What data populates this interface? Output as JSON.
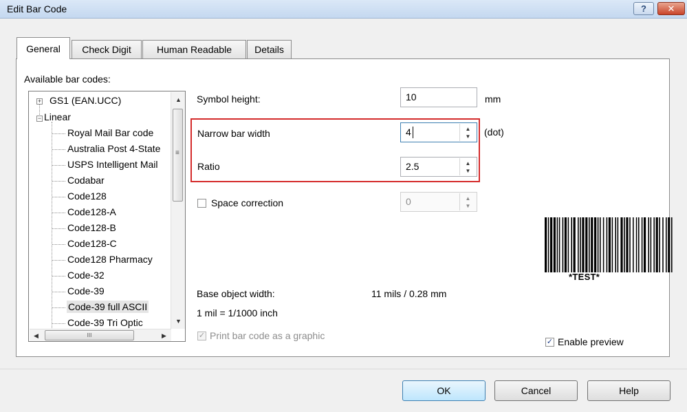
{
  "window": {
    "title": "Edit Bar Code",
    "help_glyph": "?",
    "close_glyph": "✕"
  },
  "tabs": [
    {
      "label": "General",
      "active": true
    },
    {
      "label": "Check Digit"
    },
    {
      "label": "Human Readable"
    },
    {
      "label": "Details"
    }
  ],
  "barcode_list": {
    "label": "Available bar codes:",
    "groups": [
      {
        "label": "GS1 (EAN.UCC)",
        "expander": "+"
      },
      {
        "label": "Linear",
        "expander": "−"
      }
    ],
    "items": [
      "Royal Mail Bar code",
      "Australia Post 4-State",
      "USPS Intelligent Mail",
      "Codabar",
      "Code128",
      "Code128-A",
      "Code128-B",
      "Code128-C",
      "Code128 Pharmacy",
      "Code-32",
      "Code-39",
      "Code-39 full ASCII",
      "Code-39 Tri Optic"
    ],
    "selected": "Code-39 full ASCII",
    "scroll_glyphs": {
      "up": "▲",
      "down": "▼",
      "left": "◀",
      "right": "▶",
      "thumb": "III",
      "grip": "≡"
    }
  },
  "symbol_height": {
    "label": "Symbol height:",
    "value": "10",
    "unit": "mm"
  },
  "narrow_bar_width": {
    "label": "Narrow bar width",
    "value": "4",
    "unit": "(dot)"
  },
  "ratio": {
    "label": "Ratio",
    "value": "2.5"
  },
  "space_correction": {
    "label": "Space correction",
    "checked": false,
    "value": "0"
  },
  "spin_glyphs": {
    "up": "▲",
    "down": "▼"
  },
  "check_glyph": "✓",
  "base_object_width": {
    "label": "Base object width:",
    "value": "11 mils / 0.28 mm"
  },
  "mil_note": "1 mil = 1/1000 inch",
  "print_as_graphic": {
    "label": "Print bar code as a graphic",
    "checked": true,
    "disabled": true
  },
  "enable_preview": {
    "label": "Enable preview",
    "checked": true
  },
  "preview": {
    "text": "*TEST*"
  },
  "buttons": {
    "ok": "OK",
    "cancel": "Cancel",
    "help": "Help"
  }
}
